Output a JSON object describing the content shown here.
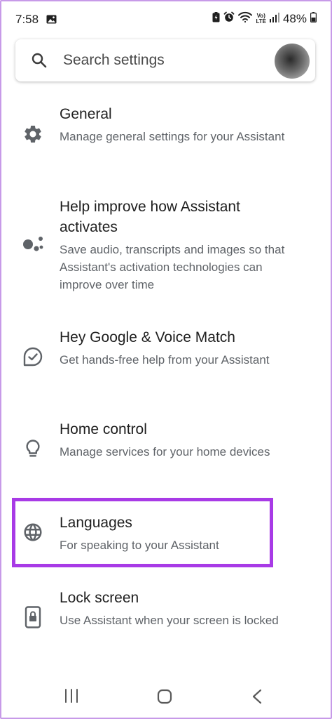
{
  "status_bar": {
    "time": "7:58",
    "volte_line1": "Vo)",
    "volte_line2": "LTE",
    "battery": "48%"
  },
  "search": {
    "placeholder": "Search settings"
  },
  "items": [
    {
      "title": "General",
      "subtitle": "Manage general settings for your Assistant",
      "icon": "gear-icon"
    },
    {
      "title": "Help improve how Assistant activates",
      "subtitle": "Save audio, transcripts and images so that Assistant's activation technologies can improve over time",
      "icon": "assistant-dots-icon"
    },
    {
      "title": "Hey Google & Voice Match",
      "subtitle": "Get hands-free help from your Assistant",
      "icon": "voice-match-icon"
    },
    {
      "title": "Home control",
      "subtitle": "Manage services for your home devices",
      "icon": "lightbulb-icon"
    },
    {
      "title": "Languages",
      "subtitle": "For speaking to your Assistant",
      "icon": "globe-icon"
    },
    {
      "title": "Lock screen",
      "subtitle": "Use Assistant when your screen is locked",
      "icon": "lock-screen-icon"
    }
  ],
  "colors": {
    "highlight": "#a83ae6",
    "frame": "#c79ae8",
    "subtitle": "#5f6368"
  }
}
